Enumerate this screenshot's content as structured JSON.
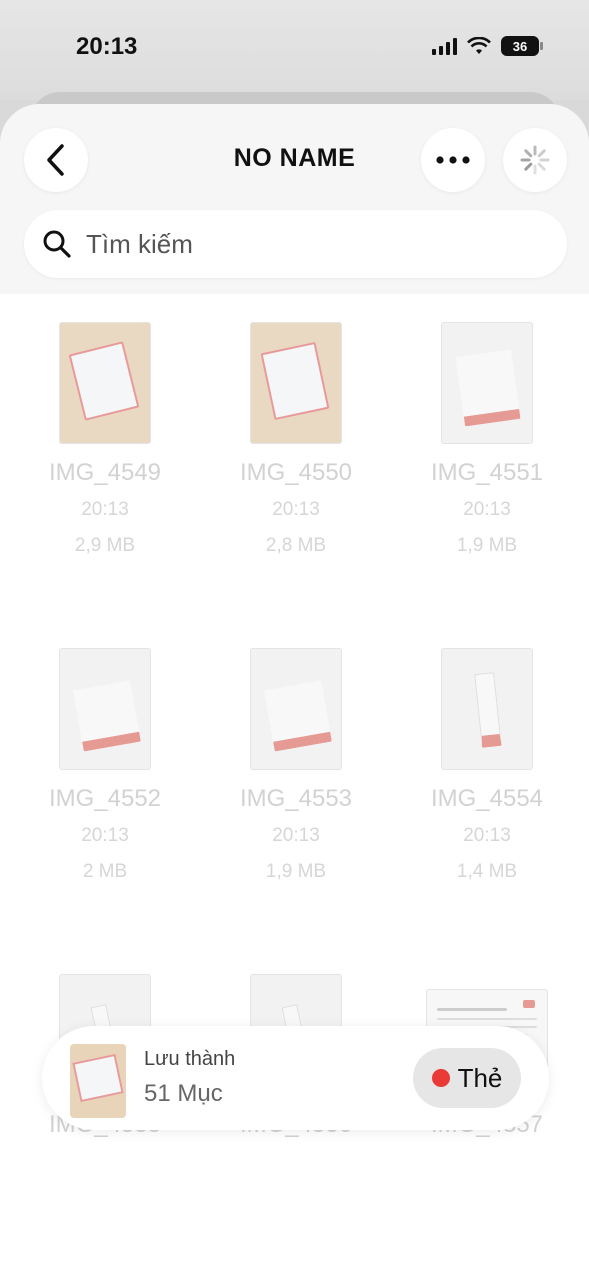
{
  "status": {
    "time": "20:13",
    "battery": "36"
  },
  "header": {
    "title": "NO NAME"
  },
  "search": {
    "placeholder": "Tìm kiếm"
  },
  "files": [
    {
      "name": "IMG_4549",
      "time": "20:13",
      "size": "2,9 MB"
    },
    {
      "name": "IMG_4550",
      "time": "20:13",
      "size": "2,8 MB"
    },
    {
      "name": "IMG_4551",
      "time": "20:13",
      "size": "1,9 MB"
    },
    {
      "name": "IMG_4552",
      "time": "20:13",
      "size": "2 MB"
    },
    {
      "name": "IMG_4553",
      "time": "20:13",
      "size": "1,9 MB"
    },
    {
      "name": "IMG_4554",
      "time": "20:13",
      "size": "1,4 MB"
    },
    {
      "name": "IMG_4555"
    },
    {
      "name": "IMG_4556"
    },
    {
      "name": "IMG_4557"
    }
  ],
  "bottom": {
    "save_label": "Lưu thành",
    "count": "51 Mục",
    "tag_label": "Thẻ"
  },
  "icons": {
    "back": "chevron-left-icon",
    "more": "more-horizontal-icon",
    "loading": "spinner-icon",
    "search": "search-icon"
  },
  "colors": {
    "accent_red": "#ea3a35"
  }
}
